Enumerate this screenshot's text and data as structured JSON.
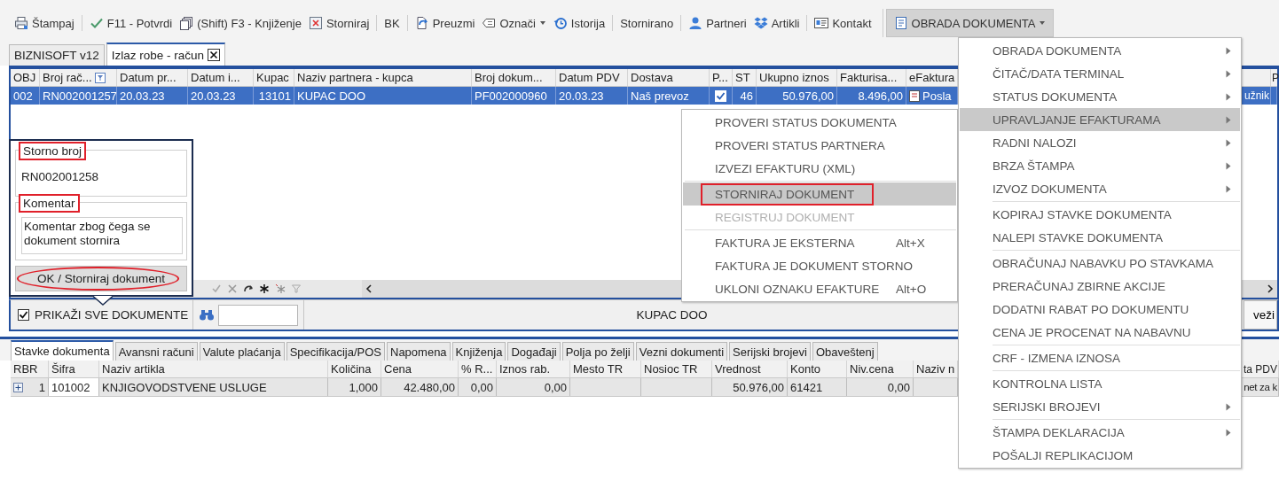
{
  "toolbar": {
    "items": [
      {
        "label": "Štampaj",
        "selected": false,
        "dropdown": false
      },
      {
        "label": "F11 - Potvrdi",
        "selected": false,
        "dropdown": false,
        "separator_before": true
      },
      {
        "label": "(Shift) F3 - Knjiženje",
        "selected": false,
        "dropdown": false
      },
      {
        "label": "Storniraj",
        "selected": false,
        "dropdown": false
      },
      {
        "label": "BK",
        "selected": false,
        "dropdown": false,
        "separator_before": true
      },
      {
        "label": "Preuzmi",
        "selected": false,
        "dropdown": false,
        "separator_before": true
      },
      {
        "label": "Označi",
        "selected": false,
        "dropdown": true
      },
      {
        "label": "Istorija",
        "selected": false,
        "dropdown": false
      },
      {
        "label": "Stornirano",
        "selected": false,
        "dropdown": false,
        "separator_before": true
      },
      {
        "label": "Partneri",
        "selected": false,
        "dropdown": false,
        "separator_before": true
      },
      {
        "label": "Artikli",
        "selected": false,
        "dropdown": false
      },
      {
        "label": "Kontakt",
        "selected": false,
        "dropdown": false,
        "separator_before": true
      },
      {
        "label": "OBRADA DOKUMENTA",
        "selected": true,
        "dropdown": true,
        "separator_before": true
      }
    ]
  },
  "doc_tabs": [
    {
      "label": "BIZNISOFT v12",
      "selected": false,
      "closable": false
    },
    {
      "label": "Izlaz robe - račun",
      "selected": true,
      "closable": true
    }
  ],
  "grid": {
    "row": {
      "selected": true
    },
    "columns": [
      {
        "header": "OBJ",
        "kind": "text",
        "cell": "002"
      },
      {
        "header": "Broj rač...",
        "kind": "text",
        "filter": true,
        "cell": "RN002001257"
      },
      {
        "header": "Datum pr...",
        "kind": "text",
        "cell": "20.03.23"
      },
      {
        "header": "Datum i...",
        "kind": "text",
        "cell": "20.03.23"
      },
      {
        "header": "Kupac",
        "kind": "num",
        "cell": "13101"
      },
      {
        "header": "Naziv partnera - kupca",
        "kind": "text",
        "cell": "KUPAC DOO"
      },
      {
        "header": "Broj dokum...",
        "kind": "text",
        "cell": "PF002000960"
      },
      {
        "header": "Datum PDV",
        "kind": "text",
        "cell": "20.03.23"
      },
      {
        "header": "Dostava",
        "kind": "text",
        "cell": "Naš prevoz"
      },
      {
        "header": "P...",
        "kind": "check",
        "checked": true
      },
      {
        "header": "ST",
        "kind": "num",
        "cell": "46"
      },
      {
        "header": "Ukupno iznos",
        "kind": "num",
        "cell": "50.976,00"
      },
      {
        "header": "Fakturisa...",
        "kind": "num",
        "cell": "8.496,00"
      },
      {
        "header": "eFaktura",
        "kind": "doc",
        "cell": "Posla"
      },
      {
        "kind": "num",
        "cell": "užnik"
      },
      {
        "header": "P",
        "kind": "text"
      }
    ]
  },
  "bottom_bar": {
    "show_all": {
      "label": "PRIKAŽI SVE DOKUMENTE",
      "checked": true
    },
    "partner": "KUPAC DOO",
    "button": "veži"
  },
  "detail_tabs": [
    {
      "label": "Stavke dokumenta",
      "selected": true
    },
    {
      "label": "Avansni računi",
      "selected": false
    },
    {
      "label": "Valute plaćanja",
      "selected": false
    },
    {
      "label": "Specifikacija/POS",
      "selected": false
    },
    {
      "label": "Napomena",
      "selected": false
    },
    {
      "label": "Knjiženja",
      "selected": false
    },
    {
      "label": "Događaji",
      "selected": false
    },
    {
      "label": "Polja po želji",
      "selected": false
    },
    {
      "label": "Vezni dokumenti",
      "selected": false
    },
    {
      "label": "Serijski brojevi",
      "selected": false
    },
    {
      "label": "Obaveštenj",
      "selected": false
    }
  ],
  "detail_grid": {
    "row": {
      "expanded": false
    },
    "columns": [
      {
        "header": "RBR",
        "kind": "rownum",
        "cell": "1"
      },
      {
        "header": "Šifra",
        "kind": "text",
        "cell": "101002"
      },
      {
        "header": "Naziv artikla",
        "kind": "text",
        "cell": "KNJIGOVODSTVENE USLUGE"
      },
      {
        "header": "Količina",
        "kind": "num",
        "cell": "1,000"
      },
      {
        "header": "Cena",
        "kind": "num",
        "cell": "42.480,00"
      },
      {
        "header": "% R...",
        "kind": "num",
        "cell": "0,00"
      },
      {
        "header": "Iznos rab.",
        "kind": "num",
        "cell": "0,00"
      },
      {
        "header": "Mesto TR",
        "kind": "text"
      },
      {
        "header": "Nosioc TR",
        "kind": "text"
      },
      {
        "header": "Vrednost",
        "kind": "num",
        "cell": "50.976,00"
      },
      {
        "header": "Konto",
        "kind": "text",
        "cell": "61421"
      },
      {
        "header": "Niv.cena",
        "kind": "num",
        "cell": "0,00"
      },
      {
        "header": "Naziv n",
        "kind": "text"
      },
      {
        "header": "ta PDV",
        "kind": "num",
        "cell": "net za k"
      }
    ]
  },
  "storno_popup": {
    "fields": [
      {
        "kind": "single",
        "label": "Storno broj",
        "value": "RN002001258",
        "annotated": true
      },
      {
        "kind": "multiline",
        "label": "Komentar",
        "value": "Komentar zbog čega se dokument stornira",
        "annotated": true
      }
    ],
    "button": {
      "label": "OK / Storniraj dokument",
      "annotated": true
    }
  },
  "submenu": {
    "items": [
      {
        "label": "PROVERI STATUS DOKUMENTA",
        "selected": false,
        "disabled": false
      },
      {
        "label": "PROVERI STATUS PARTNERA",
        "selected": false,
        "disabled": false
      },
      {
        "label": "IZVEZI EFAKTURU (XML)",
        "selected": false,
        "disabled": false
      },
      {
        "label": "STORNIRAJ DOKUMENT",
        "selected": true,
        "disabled": false,
        "separator_before": true,
        "annotated": true
      },
      {
        "label": "REGISTRUJ DOKUMENT",
        "selected": false,
        "disabled": true
      },
      {
        "label": "FAKTURA JE EKSTERNA",
        "shortcut": "Alt+X",
        "selected": false,
        "disabled": false,
        "separator_before": true
      },
      {
        "label": "FAKTURA JE DOKUMENT STORNO",
        "selected": false,
        "disabled": false
      },
      {
        "label": "UKLONI OZNAKU EFAKTURE",
        "shortcut": "Alt+O",
        "selected": false,
        "disabled": false
      }
    ]
  },
  "menu": {
    "items": [
      {
        "label": "OBRADA DOKUMENTA",
        "has_submenu": true,
        "selected": false
      },
      {
        "label": "ČITAČ/DATA TERMINAL",
        "has_submenu": true,
        "selected": false
      },
      {
        "label": "STATUS DOKUMENTA",
        "has_submenu": true,
        "selected": false
      },
      {
        "label": "UPRAVLJANJE EFAKTURAMA",
        "has_submenu": true,
        "selected": true
      },
      {
        "label": "RADNI NALOZI",
        "has_submenu": true,
        "selected": false
      },
      {
        "label": "BRZA ŠTAMPA",
        "has_submenu": true,
        "selected": false
      },
      {
        "label": "IZVOZ DOKUMENTA",
        "has_submenu": true,
        "selected": false
      },
      {
        "label": "KOPIRAJ STAVKE DOKUMENTA",
        "has_submenu": false,
        "selected": false,
        "separator_before": true
      },
      {
        "label": "NALEPI STAVKE DOKUMENTA",
        "has_submenu": false,
        "selected": false
      },
      {
        "label": "OBRAČUNAJ NABAVKU PO STAVKAMA",
        "has_submenu": false,
        "selected": false,
        "separator_before": true
      },
      {
        "label": "PRERAČUNAJ ZBIRNE AKCIJE",
        "has_submenu": false,
        "selected": false
      },
      {
        "label": "DODATNI RABAT PO DOKUMENTU",
        "has_submenu": false,
        "selected": false
      },
      {
        "label": "CENA JE PROCENAT NA NABAVNU",
        "has_submenu": false,
        "selected": false
      },
      {
        "label": "CRF - IZMENA IZNOSA",
        "has_submenu": false,
        "selected": false,
        "separator_before": true
      },
      {
        "label": "KONTROLNA LISTA",
        "has_submenu": false,
        "selected": false,
        "separator_before": true
      },
      {
        "label": "SERIJSKI BROJEVI",
        "has_submenu": true,
        "selected": false
      },
      {
        "label": "ŠTAMPA DEKLARACIJA",
        "has_submenu": true,
        "selected": false,
        "separator_before": true
      },
      {
        "label": "POŠALJI REPLIKACIJOM",
        "has_submenu": false,
        "selected": false
      }
    ]
  }
}
